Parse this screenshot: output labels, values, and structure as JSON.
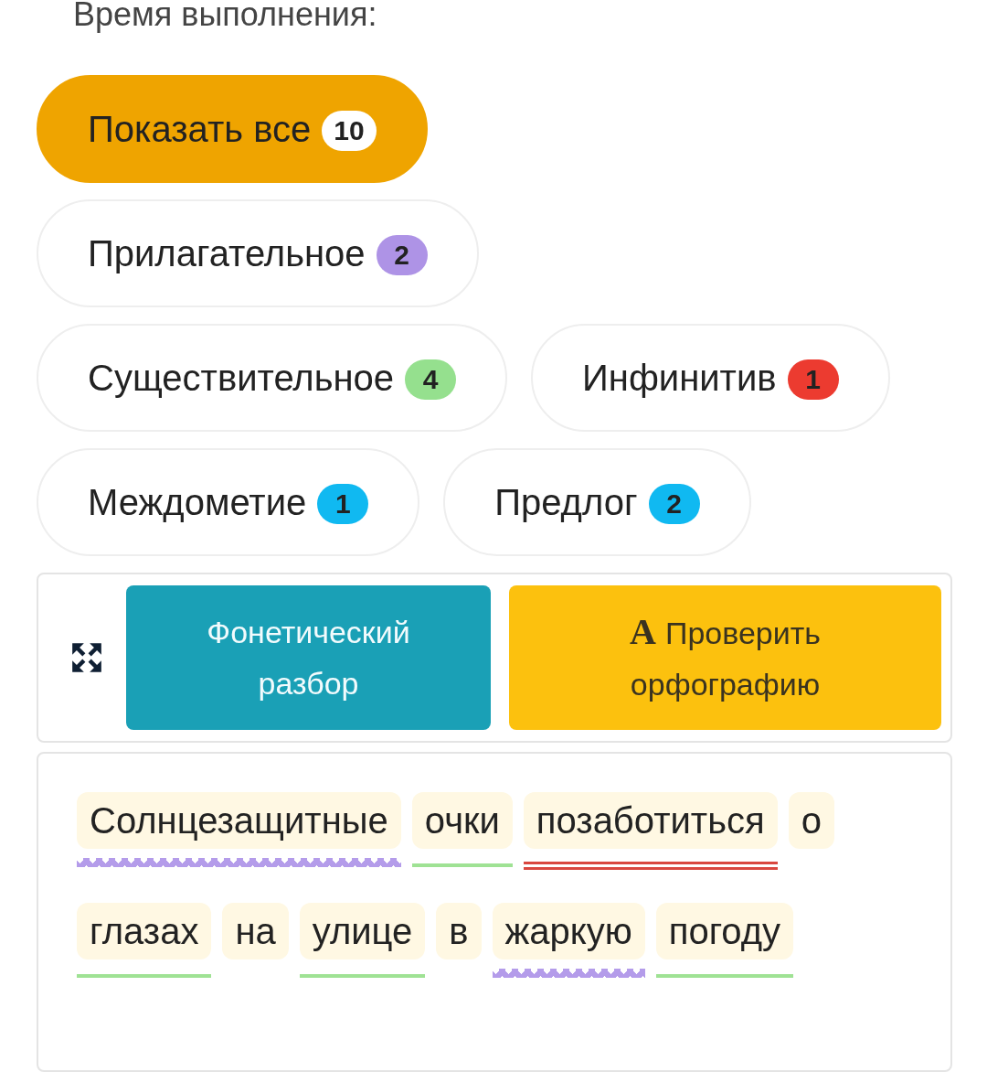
{
  "heading": "Время выполнения:",
  "filters": [
    {
      "label": "Показать все",
      "count": "10",
      "selected": true,
      "color": "#ffffff"
    },
    {
      "label": "Прилагательное",
      "count": "2",
      "selected": false,
      "color": "#ae93e6"
    },
    {
      "label": "Существительное",
      "count": "4",
      "selected": false,
      "color": "#95e08e"
    },
    {
      "label": "Инфинитив",
      "count": "1",
      "selected": false,
      "color": "#ec3b30"
    },
    {
      "label": "Междометие",
      "count": "1",
      "selected": false,
      "color": "#10b9f1"
    },
    {
      "label": "Предлог",
      "count": "2",
      "selected": false,
      "color": "#10b9f1"
    }
  ],
  "toolbar": {
    "phonetic_button": "Фонетический разбор",
    "spell_button": "Проверить орфографию",
    "spell_icon_letter": "A"
  },
  "words": [
    {
      "text": "Солнцезащитные",
      "kind": "adjective"
    },
    {
      "text": "очки",
      "kind": "noun"
    },
    {
      "text": "позаботиться",
      "kind": "infinitive"
    },
    {
      "text": "о",
      "kind": "none"
    },
    {
      "text": "глазах",
      "kind": "noun"
    },
    {
      "text": "на",
      "kind": "none"
    },
    {
      "text": "улице",
      "kind": "noun"
    },
    {
      "text": "в",
      "kind": "none"
    },
    {
      "text": "жаркую",
      "kind": "adjective"
    },
    {
      "text": "погоду",
      "kind": "noun"
    }
  ]
}
